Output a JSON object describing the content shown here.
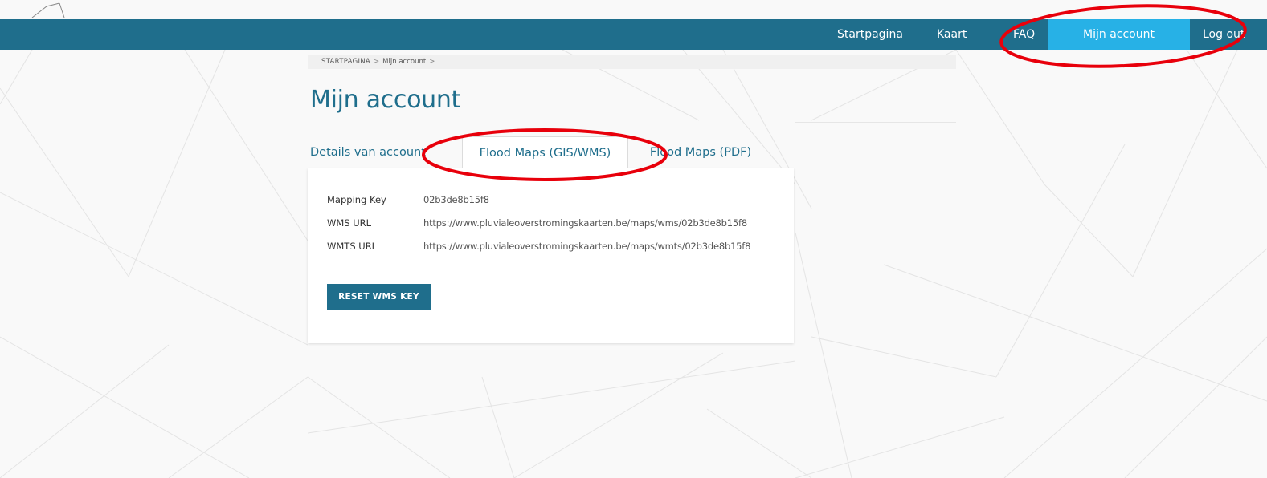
{
  "nav": {
    "items": [
      {
        "label": "Startpagina"
      },
      {
        "label": "Kaart"
      },
      {
        "label": "FAQ"
      },
      {
        "label": "Mijn account"
      },
      {
        "label": "Log out"
      }
    ],
    "active_index": 3
  },
  "breadcrumb": {
    "items": [
      "STARTPAGINA",
      "Mijn account"
    ],
    "separator": ">"
  },
  "page": {
    "title": "Mijn account"
  },
  "tabs": {
    "items": [
      {
        "label": "Details van account"
      },
      {
        "label": "Flood Maps (GIS/WMS)"
      },
      {
        "label": "Flood Maps (PDF)"
      }
    ],
    "active_index": 1
  },
  "account_details": {
    "fields": [
      {
        "label": "Mapping Key",
        "value": "02b3de8b15f8"
      },
      {
        "label": "WMS URL",
        "value": "https://www.pluvialeoverstromingskaarten.be/maps/wms/02b3de8b15f8"
      },
      {
        "label": "WMTS URL",
        "value": "https://www.pluvialeoverstromingskaarten.be/maps/wmts/02b3de8b15f8"
      }
    ],
    "reset_button_label": "RESET WMS KEY"
  },
  "colors": {
    "nav_bg": "#1f6e8c",
    "nav_active_bg": "#27b1e6",
    "accent": "#1f6e8c",
    "annotation_red": "#e8000b"
  },
  "icons": {
    "annotations": [
      "red-circle-annotation"
    ]
  }
}
